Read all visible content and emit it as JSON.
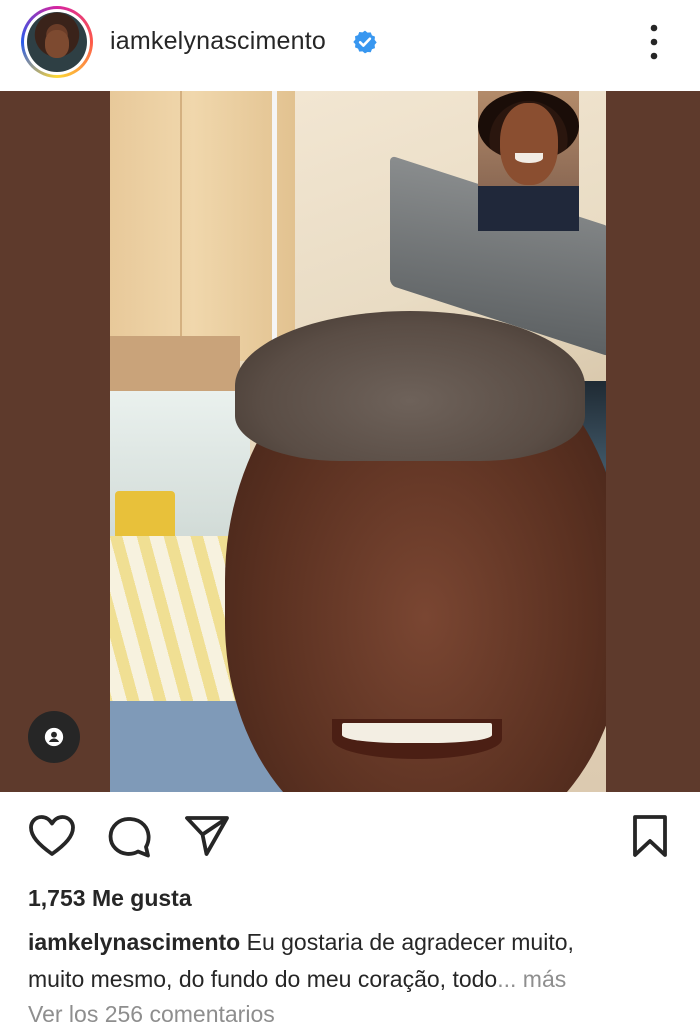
{
  "post": {
    "username": "iamkelynascimento",
    "verified": true,
    "likes": "1,753 Me gusta",
    "caption_user": "iamkelynascimento",
    "caption_line1": "Eu gostaria de agradecer muito,",
    "caption_line2": "muito mesmo, do fundo do meu  coração, todo",
    "ellipsis": "...",
    "more_label": "más",
    "view_comments": "Ver los 256 comentarios"
  },
  "icons": {
    "verified": "verified-badge-icon",
    "more": "more-vertical-icon",
    "tag": "user-tag-icon",
    "like": "heart-icon",
    "comment": "comment-icon",
    "share": "send-icon",
    "save": "bookmark-icon"
  },
  "colors": {
    "verified_blue": "#3897f0",
    "text": "#262626",
    "muted": "#8e8e8e",
    "media_border": "#5e3a2c"
  }
}
